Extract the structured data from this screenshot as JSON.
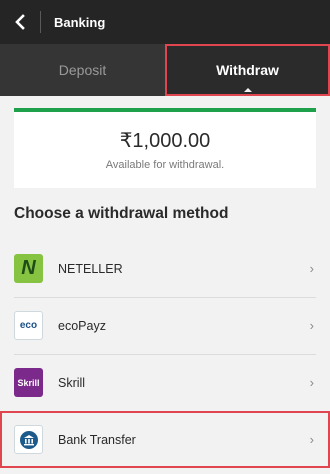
{
  "topbar": {
    "title": "Banking",
    "back_icon": "chevron-left-icon"
  },
  "tabs": [
    {
      "label": "Deposit",
      "active": false
    },
    {
      "label": "Withdraw",
      "active": true
    }
  ],
  "balance": {
    "amount": "₹1,000.00",
    "caption": "Available for withdrawal."
  },
  "section_title": "Choose a withdrawal method",
  "methods": [
    {
      "label": "NETELLER",
      "icon": "neteller-icon",
      "icon_text": "N"
    },
    {
      "label": "ecoPayz",
      "icon": "ecopayz-icon",
      "icon_text": "eco"
    },
    {
      "label": "Skrill",
      "icon": "skrill-icon",
      "icon_text": "Skrill"
    },
    {
      "label": "Bank Transfer",
      "icon": "bank-icon",
      "icon_text": ""
    }
  ],
  "chevron_glyph": "›",
  "colors": {
    "accent_green": "#1fa04a",
    "highlight_red": "#e0464f",
    "header_bg": "#252525",
    "tabs_bg": "#353535"
  }
}
